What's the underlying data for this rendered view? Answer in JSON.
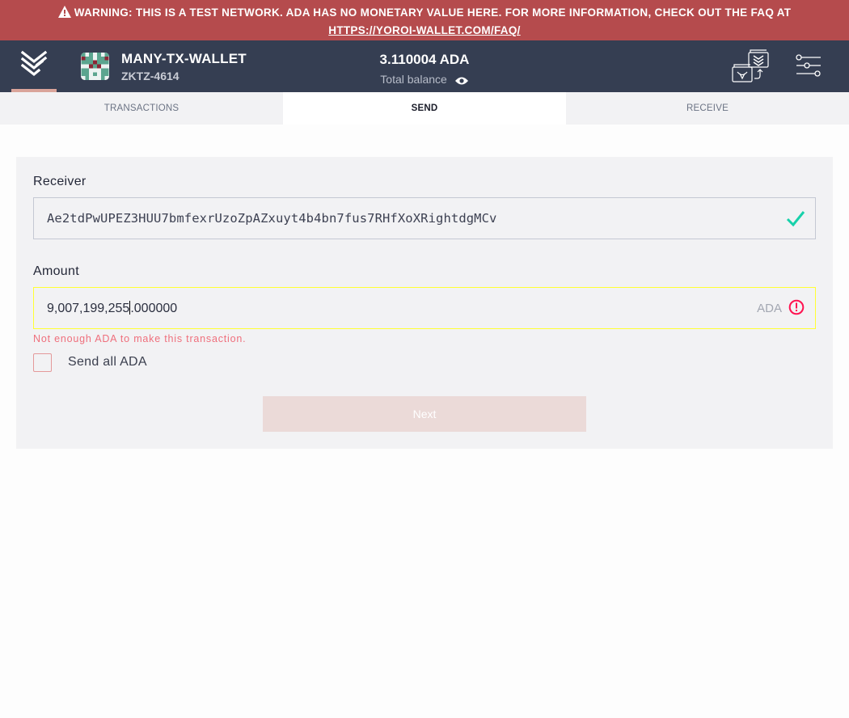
{
  "banner": {
    "text": "WARNING: THIS IS A TEST NETWORK. ADA HAS NO MONETARY VALUE HERE. FOR MORE INFORMATION, CHECK OUT THE FAQ AT",
    "link": "HTTPS://YOROI-WALLET.COM/FAQ/",
    "icon": "warning-triangle-icon",
    "color": "#b54b4d"
  },
  "topbar": {
    "logo_icon": "yoroi-logo-icon",
    "wallet_name": "MANY-TX-WALLET",
    "wallet_plate": "ZKTZ-4614",
    "balance_amount": "3.110004 ADA",
    "balance_label": "Total balance",
    "balance_visibility_icon": "eye-icon",
    "switch_wallet_icon": "switch-wallet-icon",
    "settings_icon": "settings-sliders-icon",
    "background": "#353e52"
  },
  "tabs": [
    {
      "label": "TRANSACTIONS",
      "active": false
    },
    {
      "label": "SEND",
      "active": true
    },
    {
      "label": "RECEIVE",
      "active": false
    }
  ],
  "send_form": {
    "receiver_label": "Receiver",
    "receiver_value": "Ae2tdPwUPEZ3HUU7bmfexrUzoZpAZxuyt4b4bn7fus7RHfXoXRightdgMCv",
    "receiver_valid_icon": "checkmark-icon",
    "amount_label": "Amount",
    "amount_value_before_caret": "9,007,199,255",
    "amount_value_after_caret": ".000000",
    "amount_currency": "ADA",
    "amount_error_icon": "error-circle-icon",
    "amount_error": "Not enough ADA to make this transaction.",
    "send_all_label": "Send all ADA",
    "send_all_checked": false,
    "next_label": "Next",
    "accent_valid": "#17d1aa",
    "accent_error": "#ff1351"
  }
}
